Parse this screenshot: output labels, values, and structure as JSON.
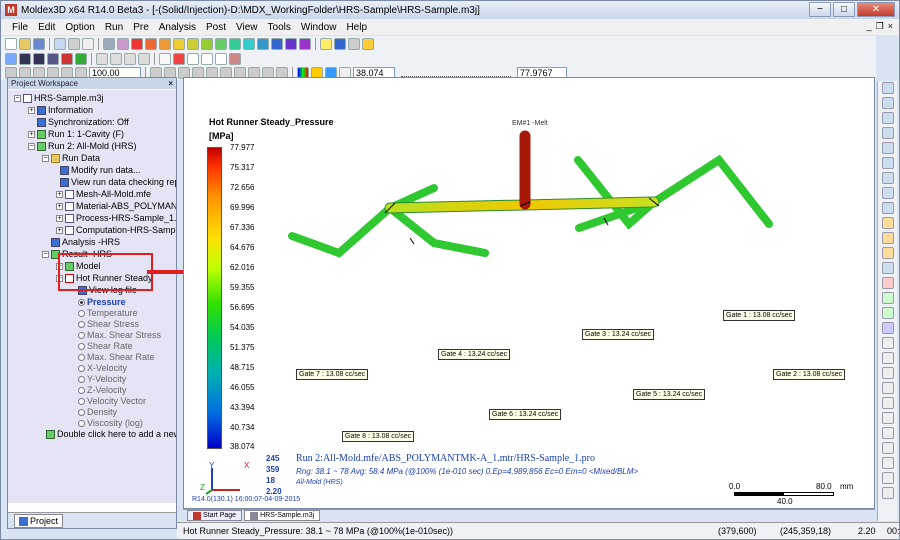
{
  "window": {
    "app_badge": "M",
    "title": "Moldex3D  x64 R14.0 Beta3 - [-(Solid/Injection)-D:\\MDX_WorkingFolder\\HRS-Sample\\HRS-Sample.m3j]",
    "controls": {
      "minimize": "−",
      "maximize": "□",
      "close": "✕"
    }
  },
  "menu": {
    "items": [
      "File",
      "Edit",
      "Option",
      "Run",
      "Pre",
      "Analysis",
      "Post",
      "View",
      "Tools",
      "Window",
      "Help"
    ],
    "mdi": [
      "_",
      "❐",
      "×"
    ]
  },
  "toolbar": {
    "zoom_value": "100.00",
    "range_min": "38.074",
    "range_max": "77.9767"
  },
  "workspace": {
    "title": "Project Workspace",
    "close": "×",
    "tab": "Project",
    "tree": [
      {
        "label": "HRS-Sample.m3j",
        "style": "normal"
      },
      {
        "label": "Information",
        "style": "normal"
      },
      {
        "label": "Synchronization: Off",
        "style": "normal"
      },
      {
        "label": "Run 1: 1-Cavity (F)",
        "style": "normal"
      },
      {
        "label": "Run 2: All-Mold (HRS)",
        "style": "normal"
      },
      {
        "label": "Run Data",
        "style": "normal"
      },
      {
        "label": "Modify run data...",
        "style": "normal"
      },
      {
        "label": "View run data checking rep",
        "style": "normal"
      },
      {
        "label": "Mesh-All-Mold.mfe",
        "style": "normal"
      },
      {
        "label": "Material-ABS_POLYMANN",
        "style": "normal"
      },
      {
        "label": "Process-HRS-Sample_1.pro",
        "style": "normal"
      },
      {
        "label": "Computation-HRS-Sample",
        "style": "normal"
      },
      {
        "label": "Analysis -HRS",
        "style": "normal"
      },
      {
        "label": "Result -HRS",
        "style": "normal"
      },
      {
        "label": "Model",
        "style": "normal"
      },
      {
        "label": "Hot Runner Steady",
        "style": "normal"
      },
      {
        "label": "View log file",
        "style": "normal"
      },
      {
        "label": "Pressure",
        "style": "selected"
      },
      {
        "label": "Temperature",
        "style": "grey"
      },
      {
        "label": "Shear Stress",
        "style": "grey"
      },
      {
        "label": "Max. Shear Stress",
        "style": "grey"
      },
      {
        "label": "Shear Rate",
        "style": "grey"
      },
      {
        "label": "Max. Shear Rate",
        "style": "grey"
      },
      {
        "label": "X-Velocity",
        "style": "grey"
      },
      {
        "label": "Y-Velocity",
        "style": "grey"
      },
      {
        "label": "Z-Velocity",
        "style": "grey"
      },
      {
        "label": "Velocity Vector",
        "style": "grey"
      },
      {
        "label": "Density",
        "style": "grey"
      },
      {
        "label": "Viscosity (log)",
        "style": "grey"
      },
      {
        "label": "Double click here to add a new",
        "style": "normal"
      }
    ]
  },
  "view": {
    "chart_title": "Hot Runner Steady_Pressure",
    "unit": "[MPa]",
    "legend_values": [
      "77.977",
      "75.317",
      "72.656",
      "69.996",
      "67.336",
      "64.676",
      "62.016",
      "59.355",
      "56.695",
      "54.035",
      "51.375",
      "48.715",
      "46.055",
      "43.394",
      "40.734",
      "38.074"
    ],
    "melt_label": "EM#1 -Melt",
    "gates": [
      {
        "label": "Gate 1 : 13.08 cc/sec"
      },
      {
        "label": "Gate 2 : 13.08 cc/sec"
      },
      {
        "label": "Gate 3 : 13.24 cc/sec"
      },
      {
        "label": "Gate 4 : 13.24 cc/sec"
      },
      {
        "label": "Gate 5 : 13.24 cc/sec"
      },
      {
        "label": "Gate 6 : 13.24 cc/sec"
      },
      {
        "label": "Gate 7 : 13.08 cc/sec"
      },
      {
        "label": "Gate 8 : 13.08 cc/sec"
      }
    ],
    "stats": [
      "245",
      "359",
      "18",
      "2.20"
    ],
    "run_info": "Run 2:All-Mold.mfe/ABS_POLYMANTMK-A_1.mtr/HRS-Sample_1.pro",
    "range_info": "Rng: 38.1 ~ 78  Avg: 58.4 MPa  (@100% (1e-010 sec) 0,Ep=4,989,856 Ec=0 Em=0 <Mixed/BLM>",
    "mold_info": "All-Mold (HRS)",
    "version": "R14.0(130.1) 16:00:07-04-09-2015",
    "axis_x": "X",
    "axis_y": "Y",
    "axis_z": "Z",
    "scale_start": "0.0",
    "scale_end": "80.0",
    "scale_unit": "mm",
    "scale_mid": "40.0"
  },
  "doc_tabs": [
    {
      "label": "Start Page",
      "active": false
    },
    {
      "label": "HRS-Sample.m3j",
      "active": true
    }
  ],
  "status": {
    "message": "Hot Runner Steady_Pressure: 38.1 ~ 78 MPa (@100%(1e-010sec))",
    "coords": "(379,600)",
    "coords3d": "(245,359,18)",
    "time": "2.20",
    "clock": "00:48:54"
  },
  "colors": {
    "accent_red": "#e02020",
    "pipe_yellow": "#e0e000",
    "pipe_green": "#20c040",
    "pipe_blue": "#1080d0",
    "sprue_red": "#e03020"
  }
}
